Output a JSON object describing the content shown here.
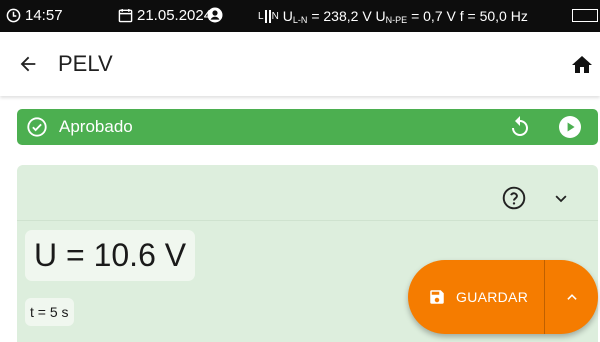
{
  "status_bar": {
    "time": "14:57",
    "date": "21.05.2024",
    "voltage_ln_label": "U",
    "voltage_ln_sub": "L-N",
    "voltage_ln_value": " = 238,2 V ",
    "voltage_npe_label": "U",
    "voltage_npe_sub": "N-PE",
    "voltage_npe_value": " = 0,7 V f = 50,0 Hz",
    "phase_l": "L",
    "phase_n": "N"
  },
  "app_bar": {
    "title": "PELV"
  },
  "result_banner": {
    "label": "Aprobado",
    "color": "#4caf50"
  },
  "measurement": {
    "main": "U = 10.6 V",
    "sub": "t = 5 s"
  },
  "fab": {
    "save_label": "GUARDAR",
    "color": "#f57c00"
  },
  "icons": {
    "clock": "clock-icon",
    "calendar": "calendar-icon",
    "user": "user-icon",
    "battery": "battery-icon",
    "back": "arrow-back-icon",
    "home": "home-icon",
    "check": "check-circle-icon",
    "repeat": "repeat-icon",
    "play": "play-icon",
    "help": "help-icon",
    "expand": "chevron-down-icon",
    "save": "save-icon",
    "more": "chevron-up-icon"
  }
}
